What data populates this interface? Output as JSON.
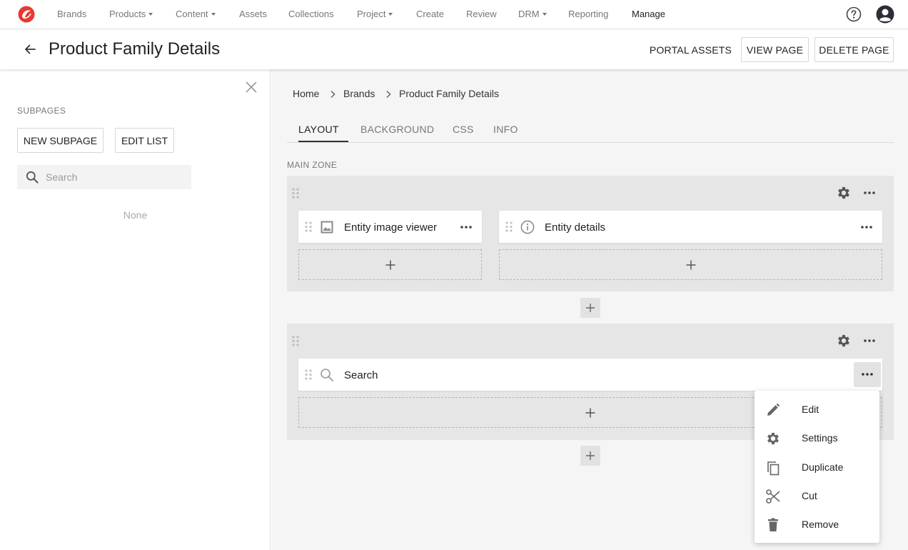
{
  "nav": {
    "items": [
      {
        "label": "Brands",
        "dropdown": false
      },
      {
        "label": "Products",
        "dropdown": true
      },
      {
        "label": "Content",
        "dropdown": true
      },
      {
        "label": "Assets",
        "dropdown": false
      },
      {
        "label": "Collections",
        "dropdown": false
      },
      {
        "label": "Project",
        "dropdown": true
      },
      {
        "label": "Create",
        "dropdown": false
      },
      {
        "label": "Review",
        "dropdown": false
      },
      {
        "label": "DRM",
        "dropdown": true
      },
      {
        "label": "Reporting",
        "dropdown": false
      },
      {
        "label": "Manage",
        "dropdown": false,
        "active": true
      }
    ],
    "logo_icon": "brand-logo-icon",
    "help_icon": "help-circle-icon",
    "avatar_icon": "user-avatar-icon",
    "brand_color": "#e8392f"
  },
  "header": {
    "title": "Product Family Details",
    "back_icon": "arrow-left-icon",
    "portal_assets_label": "PORTAL ASSETS",
    "view_page_label": "VIEW PAGE",
    "delete_page_label": "DELETE PAGE"
  },
  "sidebar": {
    "heading": "SUBPAGES",
    "new_subpage_label": "NEW SUBPAGE",
    "edit_list_label": "EDIT LIST",
    "search_placeholder": "Search",
    "empty_text": "None"
  },
  "breadcrumb": [
    "Home",
    "Brands",
    "Product Family Details"
  ],
  "tabs": [
    {
      "label": "LAYOUT",
      "active": true
    },
    {
      "label": "BACKGROUND",
      "active": false
    },
    {
      "label": "CSS",
      "active": false
    },
    {
      "label": "INFO",
      "active": false
    }
  ],
  "zone": {
    "label": "MAIN ZONE",
    "sections": [
      {
        "components": [
          {
            "label": "Entity image viewer",
            "icon": "image-icon"
          },
          {
            "label": "Entity details",
            "icon": "info-icon"
          }
        ]
      },
      {
        "components": [
          {
            "label": "Search",
            "icon": "search-icon"
          }
        ]
      }
    ]
  },
  "context_menu": {
    "items": [
      {
        "label": "Edit",
        "icon": "pencil-icon"
      },
      {
        "label": "Settings",
        "icon": "gear-icon"
      },
      {
        "label": "Duplicate",
        "icon": "copy-icon"
      },
      {
        "label": "Cut",
        "icon": "scissors-icon"
      },
      {
        "label": "Remove",
        "icon": "trash-icon"
      }
    ]
  }
}
